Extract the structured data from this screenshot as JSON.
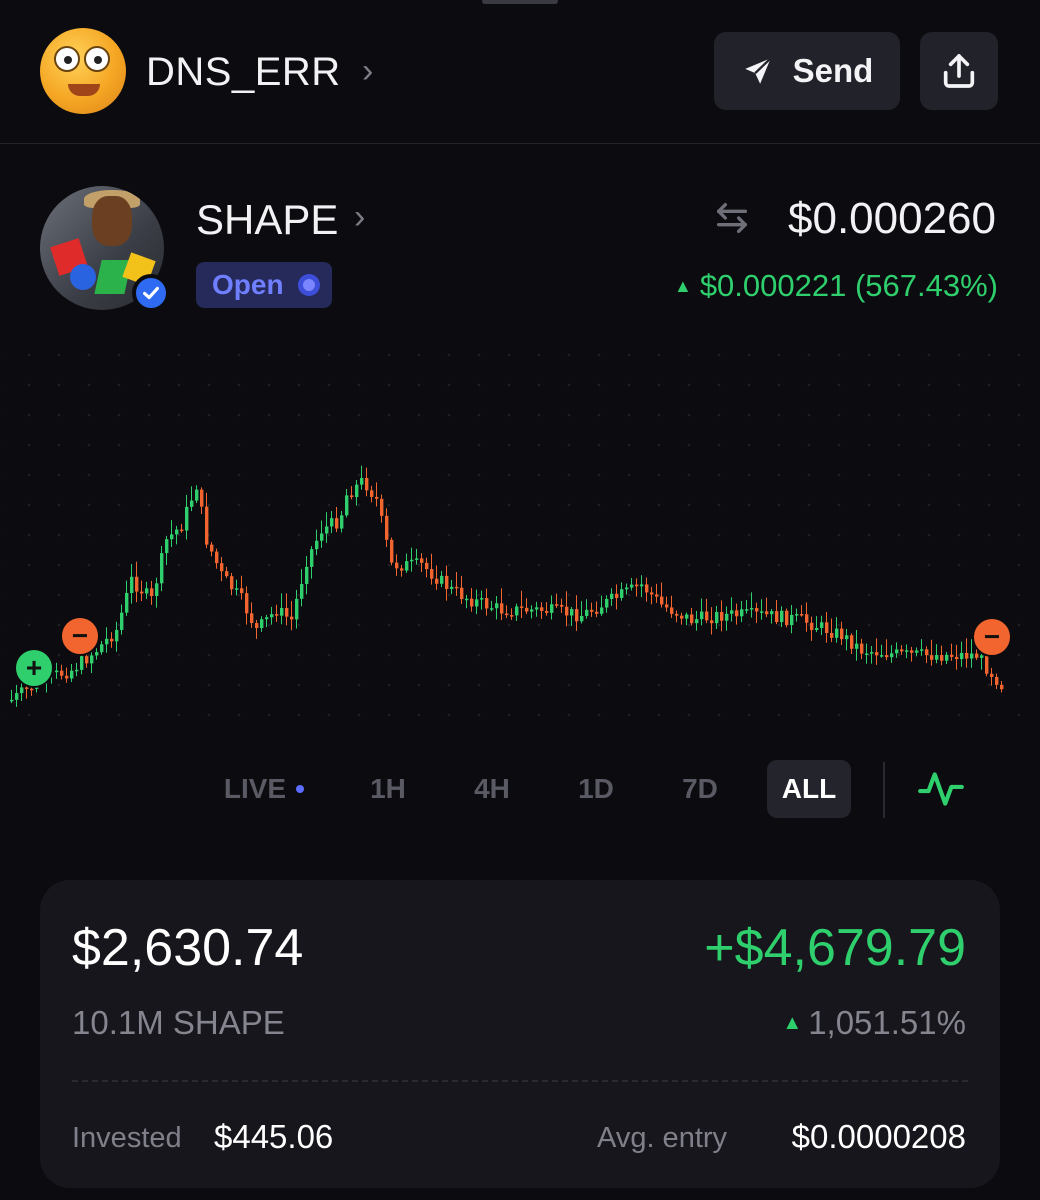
{
  "header": {
    "account_name": "DNS_ERR",
    "chevron": "›",
    "send_label": "Send",
    "avatar_icon": "emoji-face-icon",
    "send_icon": "paper-plane-icon",
    "share_icon": "share-upload-icon"
  },
  "token": {
    "name": "SHAPE",
    "chevron": "›",
    "status": "Open",
    "price": "$0.000260",
    "change_arrow": "▲",
    "change": "$0.000221 (567.43%)",
    "verified_icon": "verified-check-icon",
    "swap_icon": "swap-arrows-icon"
  },
  "chart": {
    "buy_marker": "+",
    "sell_marker": "−"
  },
  "timeframes": {
    "live": "LIVE",
    "h1": "1H",
    "h4": "4H",
    "d1": "1D",
    "d7": "7D",
    "all": "ALL",
    "active": "ALL",
    "chart_type_icon": "line-chart-icon"
  },
  "position": {
    "value": "$2,630.74",
    "pnl": "+$4,679.79",
    "holdings": "10.1M SHAPE",
    "pnl_arrow": "▲",
    "pnl_pct": "1,051.51%",
    "invested_label": "Invested",
    "invested": "$445.06",
    "entry_label": "Avg. entry",
    "entry": "$0.0000208"
  },
  "colors": {
    "background": "#0c0c10",
    "up": "#2ecf6c",
    "down": "#f2652e",
    "accent": "#6f7fff"
  }
}
